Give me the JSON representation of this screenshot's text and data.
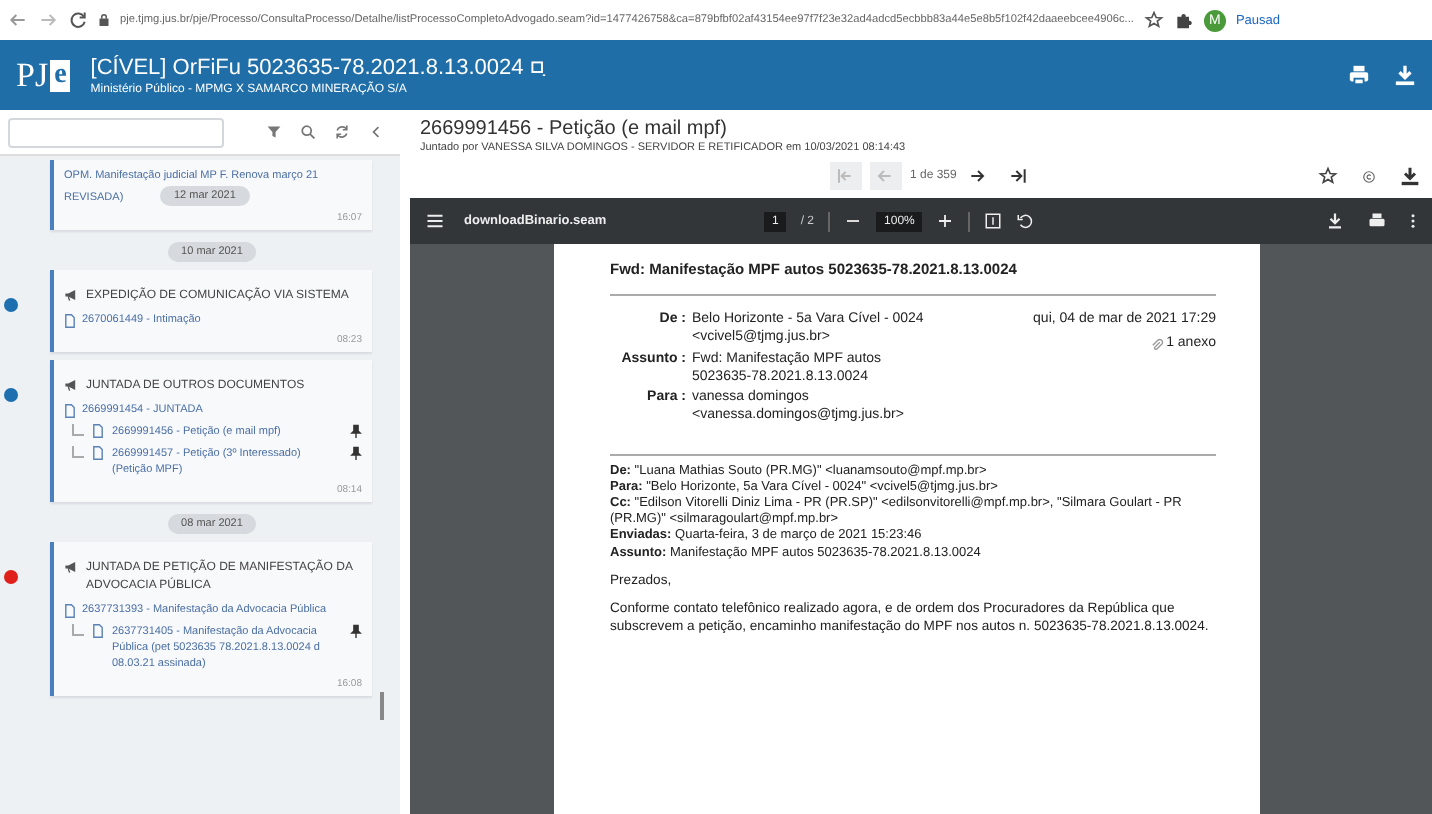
{
  "browser": {
    "url": "pje.tjmg.jus.br/pje/Processo/ConsultaProcesso/Detalhe/listProcessoCompletoAdvogado.seam?id=1477426758&ca=879bfbf02af43154ee97f7f23e32ad4adcd5ecbbb83a44e5e8b5f102f42daaeebcee4906c...",
    "profile_initial": "M",
    "profile_status": "Pausad"
  },
  "header": {
    "logo_main": "PJ",
    "logo_accent": "e",
    "title": "[CÍVEL] OrFiFu 5023635-78.2021.8.13.0024",
    "subtitle": "Ministério Público - MPMG X SAMARCO MINERAÇÃO S/A"
  },
  "timeline": {
    "sticky_date": "12 mar 2021",
    "entries": [
      {
        "kind": "event",
        "lines": [
          "OPM. Manifestação judicial MP F. Renova março 21",
          "REVISADA)"
        ],
        "time": "16:07"
      },
      {
        "kind": "date",
        "label": "10 mar 2021"
      },
      {
        "kind": "event",
        "color": "#1e6fb0",
        "title": "EXPEDIÇÃO DE COMUNICAÇÃO VIA SISTEMA",
        "document": {
          "label": "2670061449 - Intimação"
        },
        "time": "08:23"
      },
      {
        "kind": "event",
        "color": "#1e6fb0",
        "title": "JUNTADA DE OUTROS DOCUMENTOS",
        "document": {
          "label": "2669991454 - JUNTADA",
          "children": [
            {
              "label": "2669991456 - Petição (e mail mpf)",
              "pinned": true
            },
            {
              "label": "2669991457 - Petição (3º Interessado) (Petição MPF)",
              "pinned": true
            }
          ]
        },
        "time": "08:14"
      },
      {
        "kind": "date",
        "label": "08 mar 2021"
      },
      {
        "kind": "event",
        "color": "#e0201b",
        "title": "JUNTADA DE PETIÇÃO DE MANIFESTAÇÃO DA ADVOCACIA PÚBLICA",
        "document": {
          "label": "2637731393 - Manifestação da Advocacia Pública",
          "children": [
            {
              "label": "2637731405 - Manifestação da Advocacia Pública (pet 5023635 78.2021.8.13.0024 d 08.03.21 assinada)",
              "pinned": true
            }
          ]
        },
        "time": "16:08"
      }
    ]
  },
  "document": {
    "title": "2669991456 - Petição (e mail mpf)",
    "joined_by": "Juntado por VANESSA SILVA DOMINGOS - SERVIDOR E RETIFICADOR em 10/03/2021 08:14:43"
  },
  "pager": {
    "position": "1 de 359",
    "nav": [
      {
        "kind": "first",
        "disabled": true
      },
      {
        "kind": "prev",
        "disabled": true
      },
      {
        "kind": "next",
        "disabled": false
      },
      {
        "kind": "last",
        "disabled": false
      }
    ]
  },
  "viewer": {
    "filename": "downloadBinario.seam",
    "page": "1",
    "pages": "/ 2",
    "zoom": "100%"
  },
  "email": {
    "subject": "Fwd: Manifestação MPF autos 5023635-78.2021.8.13.0024",
    "date": "qui, 04 de mar de 2021 17:29",
    "attachments": "1 anexo",
    "fields": [
      {
        "label": "De :",
        "value": "Belo Horizonte - 5a Vara Cível - 0024\n<vcivel5@tjmg.jus.br>"
      },
      {
        "label": "Assunto :",
        "value": "Fwd: Manifestação MPF autos\n5023635-78.2021.8.13.0024"
      },
      {
        "label": "Para :",
        "value": "vanessa domingos\n<vanessa.domingos@tjmg.jus.br>"
      }
    ],
    "forwarded": [
      "**De:** \"Luana Mathias Souto (PR.MG)\" <luanamsouto@mpf.mp.br>",
      "**Para:** \"Belo Horizonte, 5a Vara Cível - 0024\" <vcivel5@tjmg.jus.br>",
      "**Cc:** \"Edilson Vitorelli Diniz Lima - PR (PR.SP)\" <edilsonvitorelli@mpf.mp.br>, \"Silmara Goulart - PR (PR.MG)\" <silmaragoulart@mpf.mp.br>",
      "**Enviadas:** Quarta-feira, 3 de março de 2021 15:23:46",
      "**Assunto:** Manifestação MPF autos 5023635-78.2021.8.13.0024"
    ],
    "greeting": "Prezados,",
    "body": "Conforme contato telefônico realizado agora, e de ordem dos Procuradores da República que subscrevem a petição, encaminho manifestação do MPF nos autos n. 5023635-78.2021.8.13.0024."
  }
}
